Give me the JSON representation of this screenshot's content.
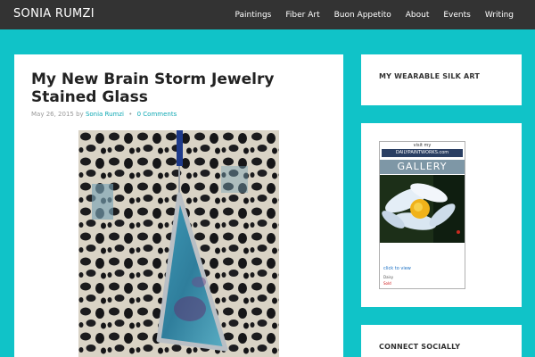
{
  "site": {
    "title": "SONIA RUMZI"
  },
  "nav": {
    "items": [
      {
        "label": "Paintings"
      },
      {
        "label": "Fiber Art"
      },
      {
        "label": "Buon Appetito"
      },
      {
        "label": "About"
      },
      {
        "label": "Events"
      },
      {
        "label": "Writing"
      }
    ]
  },
  "post": {
    "title": "My New Brain Storm Jewelry Stained Glass",
    "date": "May 26, 2015",
    "by": "by",
    "author": "Sonia Rumzi",
    "comments": "0 Comments"
  },
  "sidebar": {
    "widget1": {
      "title": "MY WEARABLE SILK ART"
    },
    "widget2": {
      "visit": "visit my",
      "brand": "DAILYPAINTWORKS.com",
      "gallery": "GALLERY",
      "click": "click to view",
      "painting": "Daisy",
      "status": "Sold"
    },
    "widget3": {
      "title": "CONNECT SOCIALLY"
    }
  },
  "colors": {
    "background": "#10c3c8",
    "topbar": "#333333",
    "link": "#10a9b4"
  }
}
